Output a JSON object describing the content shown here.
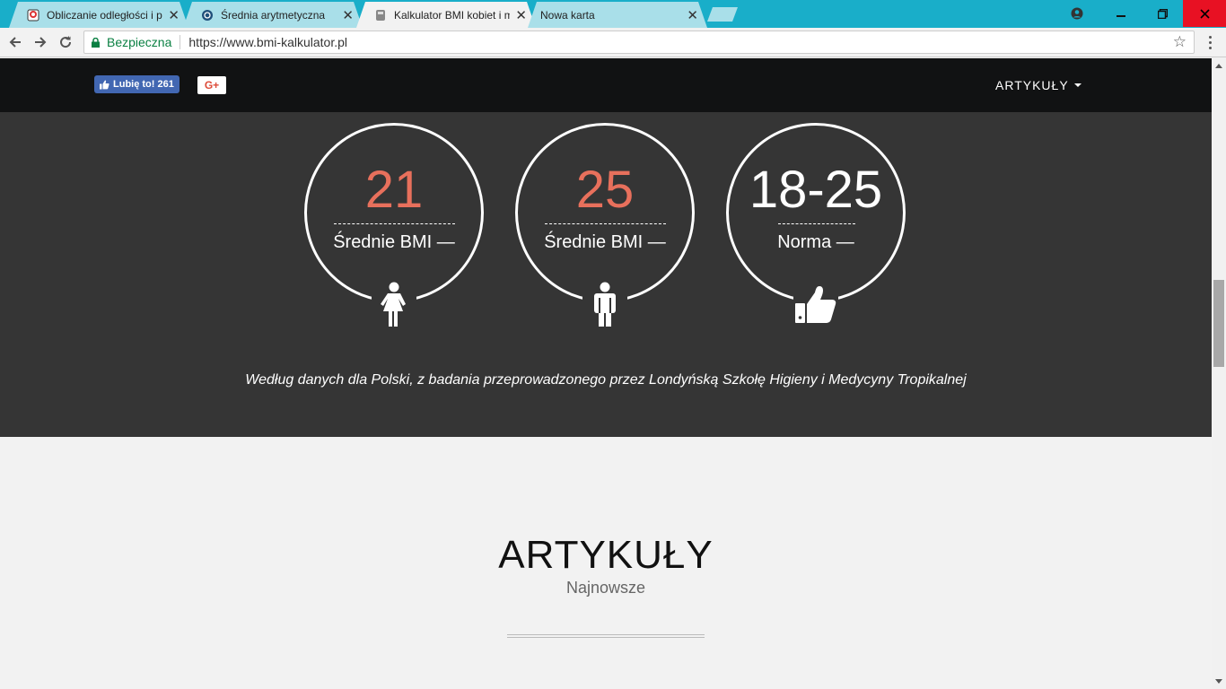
{
  "browser": {
    "tabs": [
      {
        "title": "Obliczanie odległości i p",
        "icon": "maps-app-icon",
        "active": false
      },
      {
        "title": "Średnia arytmetyczna",
        "icon": "globe-site-icon",
        "active": false
      },
      {
        "title": "Kalkulator BMI kobiet i m",
        "icon": "bmi-site-icon",
        "active": true
      },
      {
        "title": "Nowa karta",
        "icon": "",
        "active": false
      }
    ],
    "security_label": "Bezpieczna",
    "url": "https://www.bmi-kalkulator.pl"
  },
  "site": {
    "fb_like_label": "Lubię to! 261",
    "gplus_label": "G+",
    "nav_menu_label": "ARTYKUŁY"
  },
  "stats": [
    {
      "value": "21",
      "label": "Średnie BMI —",
      "icon": "female-icon",
      "value_color": "#e8705c"
    },
    {
      "value": "25",
      "label": "Średnie BMI —",
      "icon": "male-icon",
      "value_color": "#e8705c"
    },
    {
      "value": "18-25",
      "label": "Norma —",
      "icon": "thumbs-up-icon",
      "value_color": "#ffffff"
    }
  ],
  "source_note": "Według danych dla Polski, z badania przeprowadzonego przez Londyńską Szkołę Higieny i Medycyny Tropikalnej",
  "articles": {
    "heading": "ARTYKUŁY",
    "subheading": "Najnowsze"
  }
}
